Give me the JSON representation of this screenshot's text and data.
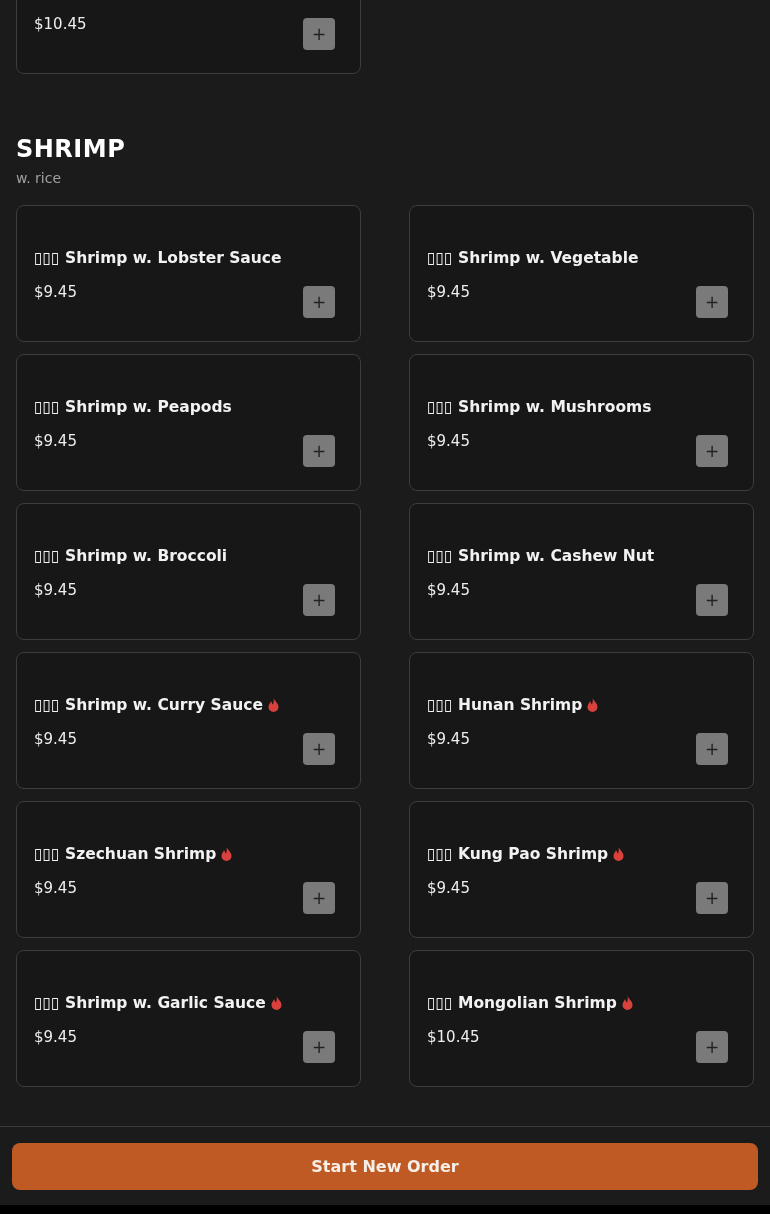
{
  "previous_item": {
    "price": "$10.45",
    "add_button": "+"
  },
  "add_button": "+",
  "section": {
    "title": "SHRIMP",
    "subtitle": "w. rice"
  },
  "items": [
    {
      "name": "▯▯▯ Shrimp w. Lobster Sauce",
      "price": "$9.45",
      "spicy": false
    },
    {
      "name": "▯▯▯ Shrimp w. Vegetable",
      "price": "$9.45",
      "spicy": false
    },
    {
      "name": "▯▯▯ Shrimp w. Peapods",
      "price": "$9.45",
      "spicy": false
    },
    {
      "name": "▯▯▯ Shrimp w. Mushrooms",
      "price": "$9.45",
      "spicy": false
    },
    {
      "name": "▯▯▯ Shrimp w. Broccoli",
      "price": "$9.45",
      "spicy": false
    },
    {
      "name": "▯▯▯ Shrimp w. Cashew Nut",
      "price": "$9.45",
      "spicy": false
    },
    {
      "name": "▯▯▯ Shrimp w. Curry Sauce",
      "price": "$9.45",
      "spicy": true
    },
    {
      "name": "▯▯▯ Hunan Shrimp",
      "price": "$9.45",
      "spicy": true
    },
    {
      "name": "▯▯▯ Szechuan Shrimp",
      "price": "$9.45",
      "spicy": true
    },
    {
      "name": "▯▯▯ Kung Pao Shrimp",
      "price": "$9.45",
      "spicy": true
    },
    {
      "name": "▯▯▯ Shrimp w. Garlic Sauce",
      "price": "$9.45",
      "spicy": true
    },
    {
      "name": "▯▯▯ Mongolian Shrimp",
      "price": "$10.45",
      "spicy": true
    }
  ],
  "footer": {
    "button": "Start New Order"
  }
}
